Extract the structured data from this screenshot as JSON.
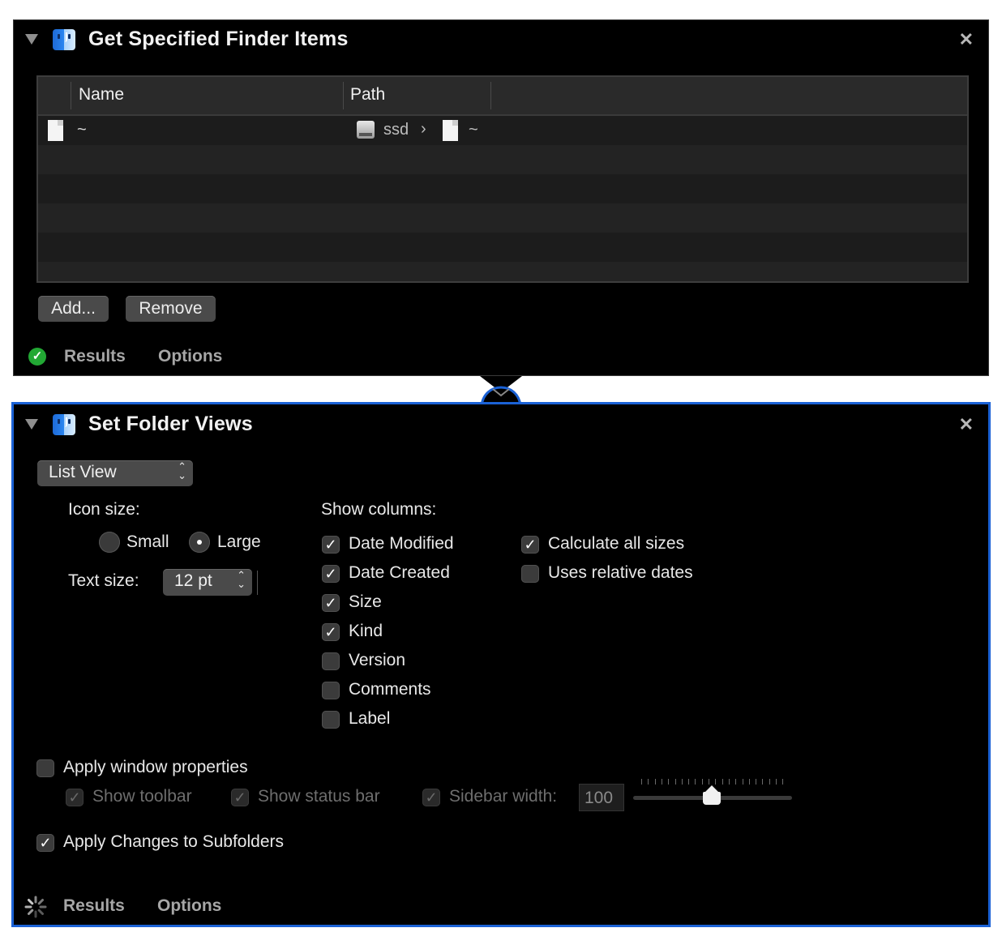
{
  "action1": {
    "title": "Get Specified Finder Items",
    "close": "✕",
    "table": {
      "columns": [
        "Name",
        "Path"
      ],
      "rows": [
        {
          "name": "~",
          "path_disk": "ssd",
          "path_sep": "›",
          "path_item": "~"
        }
      ]
    },
    "buttons": {
      "add": "Add...",
      "remove": "Remove"
    },
    "footer": {
      "results": "Results",
      "options": "Options",
      "status": "✓"
    }
  },
  "action2": {
    "title": "Set Folder Views",
    "close": "✕",
    "view_select": "List View",
    "icon_size": {
      "label": "Icon size:",
      "small": "Small",
      "large": "Large",
      "selected": "Large"
    },
    "text_size": {
      "label": "Text size:",
      "value": "12 pt"
    },
    "show_columns": {
      "label": "Show columns:",
      "items": [
        {
          "label": "Date Modified",
          "checked": true
        },
        {
          "label": "Date Created",
          "checked": true
        },
        {
          "label": "Size",
          "checked": true
        },
        {
          "label": "Kind",
          "checked": true
        },
        {
          "label": "Version",
          "checked": false
        },
        {
          "label": "Comments",
          "checked": false
        },
        {
          "label": "Label",
          "checked": false
        }
      ]
    },
    "extra_options": [
      {
        "label": "Calculate all sizes",
        "checked": true
      },
      {
        "label": "Uses relative dates",
        "checked": false
      }
    ],
    "window_props": {
      "label": "Apply window properties",
      "checked": false,
      "show_toolbar": "Show toolbar",
      "show_status_bar": "Show status bar",
      "sidebar_width_label": "Sidebar width:",
      "sidebar_width_value": "100"
    },
    "apply_subfolders": {
      "label": "Apply Changes to Subfolders",
      "checked": true
    },
    "footer": {
      "results": "Results",
      "options": "Options"
    }
  },
  "colors": {
    "accent": "#1b62d6",
    "panel_bg": "#000000",
    "ok": "#22a834"
  },
  "icons": [
    "disclosure-triangle-icon",
    "finder-icon",
    "close-icon",
    "document-icon",
    "disk-icon",
    "checkmark-icon",
    "spinner-icon"
  ]
}
